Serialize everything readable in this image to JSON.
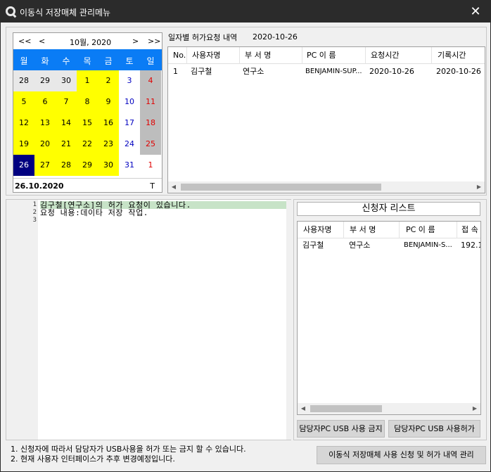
{
  "window": {
    "title": "이동식 저장매체 관리메뉴",
    "close_glyph": "✕"
  },
  "calendar": {
    "nav_prev_year": "<<",
    "nav_prev_month": "<",
    "month_label": "10월, 2020",
    "nav_next_month": ">",
    "nav_next_year": ">>",
    "weekdays": [
      "월",
      "화",
      "수",
      "목",
      "금",
      "토",
      "일"
    ],
    "weeks": [
      [
        "28",
        "29",
        "30",
        "1",
        "2",
        "3",
        "4"
      ],
      [
        "5",
        "6",
        "7",
        "8",
        "9",
        "10",
        "11"
      ],
      [
        "12",
        "13",
        "14",
        "15",
        "16",
        "17",
        "18"
      ],
      [
        "19",
        "20",
        "21",
        "22",
        "23",
        "24",
        "25"
      ],
      [
        "26",
        "27",
        "28",
        "29",
        "30",
        "31",
        "1"
      ]
    ],
    "selected_date": "26.10.2020",
    "today_button": "T",
    "colors": {
      "header": "#0a7cf5",
      "highlight": "#ffff00",
      "selected": "#000080",
      "weekend_gray": "#bdbdbd",
      "sunday_text": "#e00000",
      "saturday_text": "#0000c0"
    }
  },
  "requests": {
    "label": "일자별 허가요청 내역",
    "date": "2020-10-26",
    "columns": [
      "No.",
      "사용자명",
      "부 서 명",
      "PC 이 름",
      "요청시간",
      "기록시간"
    ],
    "rows": [
      [
        "1",
        "김구철",
        "연구소",
        "BENJAMIN-SUP...",
        "2020-10-26",
        "2020-10-26"
      ]
    ]
  },
  "editor": {
    "line_numbers": [
      "1",
      "2",
      "3"
    ],
    "lines": [
      "김구철[연구소]의 허가 요청이 있습니다.",
      "요청 내용:데이타 저장 작업.",
      ""
    ]
  },
  "applicants": {
    "title": "신청자 리스트",
    "columns": [
      "사용자명",
      "부 서 명",
      "PC 이 름",
      "접 속"
    ],
    "rows": [
      [
        "김구철",
        "연구소",
        "BENJAMIN-S...",
        "192.1"
      ]
    ]
  },
  "buttons": {
    "deny": "담당자PC USB 사용 금지",
    "allow": "담당자PC USB 사용허가",
    "history": "이동식 저장매체 사용 신청 및 허가 내역 관리"
  },
  "notes": [
    "1. 신청자에 따라서 담당자가 USB사용을 허가 또는 금지 할 수 있습니다.",
    "2. 현재 사용자 인터페이스가 추후 변경예정입니다."
  ]
}
